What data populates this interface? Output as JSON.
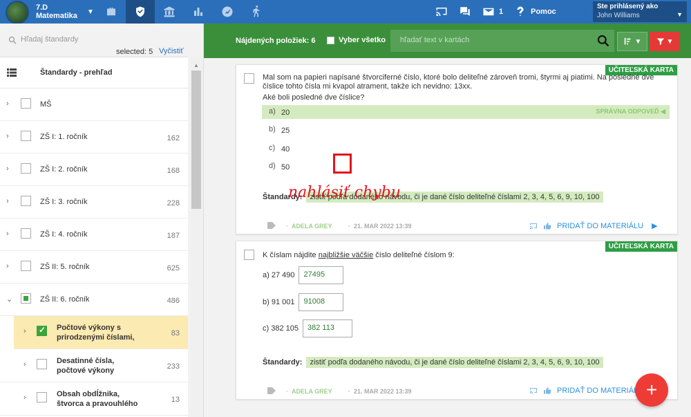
{
  "topbar": {
    "class_name": "7.D",
    "subject": "Matematika",
    "message_count": "1",
    "help_label": "Pomoc",
    "logged_in_label": "Ste prihlásený ako",
    "user_name": "John Williams",
    "nav_icons": [
      "briefcase-icon",
      "shield-icon",
      "institution-icon",
      "bar-chart-icon",
      "analytics-icon",
      "person-walking-icon"
    ],
    "accent": "#2b6fba"
  },
  "sidebar": {
    "search_placeholder": "Hľadaj štandardy",
    "selected_label": "selected: 5",
    "clear_label": "Vyčistiť",
    "header_title": "Štandardy - prehľad",
    "items": [
      {
        "label": "MŠ",
        "count": ""
      },
      {
        "label": "ZŠ I: 1. ročník",
        "count": "162"
      },
      {
        "label": "ZŠ I: 2. ročník",
        "count": "168"
      },
      {
        "label": "ZŠ I: 3. ročník",
        "count": "228"
      },
      {
        "label": "ZŠ I: 4. ročník",
        "count": "187"
      },
      {
        "label": "ZŠ II: 5. ročník",
        "count": "625"
      },
      {
        "label": "ZŠ II: 6. ročník",
        "count": "486"
      }
    ],
    "subitems": [
      {
        "label_1": "Počtové výkony s",
        "label_2": "prirodzenými číslami,",
        "count": "83"
      },
      {
        "label_1": "Desatinné čísla,",
        "label_2": "počtové výkony",
        "count": "233"
      },
      {
        "label_1": "Obsah obdĺžnika,",
        "label_2": "štvorca a pravouhlého",
        "count": "13"
      }
    ]
  },
  "filterbar": {
    "found_label": "Nájdených položiek: 6",
    "select_all_label": "Vyber všetko",
    "search_placeholder": "hľadať text v kartách",
    "bar_color": "#3b8f3b"
  },
  "cards": [
    {
      "badge": "UČITEĽSKÁ KARTA",
      "question": "Mal som na papieri napísané štvorciferné číslo, ktoré bolo deliteľné zároveň tromi, štyrmi aj piatimi. Na posledné dve číslice tohto čísla mi kvapol atrament, takže ich nevidno: 13xx.",
      "subquestion": "Aké boli posledné dve číslice?",
      "answers": [
        {
          "key": "a)",
          "value": "20"
        },
        {
          "key": "b)",
          "value": "25"
        },
        {
          "key": "c)",
          "value": "40"
        },
        {
          "key": "d)",
          "value": "50"
        }
      ],
      "correct_label": "SPRÁVNA ODPOVEĎ",
      "standards_label": "Štandardy:",
      "standard": "zistiť podľa dodaného návodu, či je dané číslo deliteľné číslami 2, 3, 4, 5, 6, 9, 10, 100",
      "author": "ADELA GREY",
      "date": "21. MAR 2022 13:39",
      "add_label": "PRIDAŤ DO MATERIÁLU"
    },
    {
      "badge": "UČITEĽSKÁ KARTA",
      "q_pre": "K číslam nájdite ",
      "q_u": "najbližšie väčšie",
      "q_post": " číslo deliteľné číslom 9:",
      "rows": [
        {
          "label": "a) 27 490",
          "value": "27495"
        },
        {
          "label": "b) 91 001",
          "value": "91008"
        },
        {
          "label": "c) 382 105",
          "value": "382 113"
        }
      ],
      "standards_label": "Štandardy:",
      "standard": "zistiť podľa dodaného návodu, či je dané číslo deliteľné číslami 2, 3, 4, 5, 6, 9, 10, 100",
      "author": "ADELA GREY",
      "date": "21. MAR 2022 13:39",
      "add_label": "PRIDAŤ DO MATERIÁLU"
    }
  ],
  "annotation": {
    "text": "nahlásiť chybu",
    "color": "#e1141b"
  },
  "fab_label": "+"
}
